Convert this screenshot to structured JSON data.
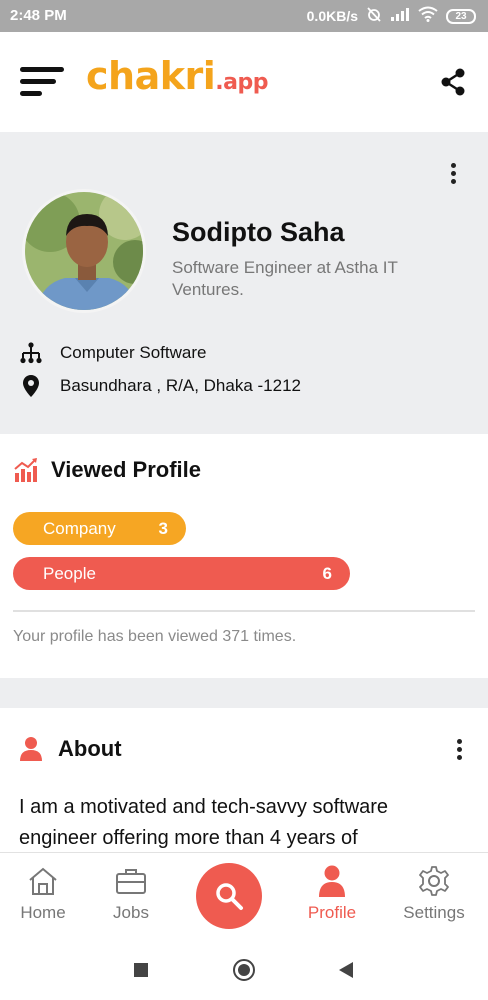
{
  "status_bar": {
    "time": "2:48 PM",
    "network_speed": "0.0KB/s",
    "battery": "23"
  },
  "header": {
    "logo_main": "chakri",
    "logo_suffix": ".app"
  },
  "profile": {
    "name": "Sodipto Saha",
    "title": "Software Engineer at Astha IT Ventures.",
    "industry": "Computer Software",
    "address": "Basundhara , R/A, Dhaka -1212"
  },
  "viewed_profile": {
    "heading": "Viewed Profile",
    "bars": [
      {
        "label": "Company",
        "count": "3",
        "color": "#f6a623",
        "fraction": 0.375
      },
      {
        "label": "People",
        "count": "6",
        "color": "#ef5b50",
        "fraction": 0.73
      }
    ],
    "note": "Your profile has been viewed 371 times."
  },
  "about": {
    "heading": "About",
    "text": "I am a motivated and tech-savvy software engineer offering more than 4 years of"
  },
  "bottom_nav": {
    "home": "Home",
    "jobs": "Jobs",
    "profile": "Profile",
    "settings": "Settings"
  },
  "colors": {
    "accent": "#ef5b50",
    "orange": "#f6a623",
    "logo": "#f4a41c"
  }
}
